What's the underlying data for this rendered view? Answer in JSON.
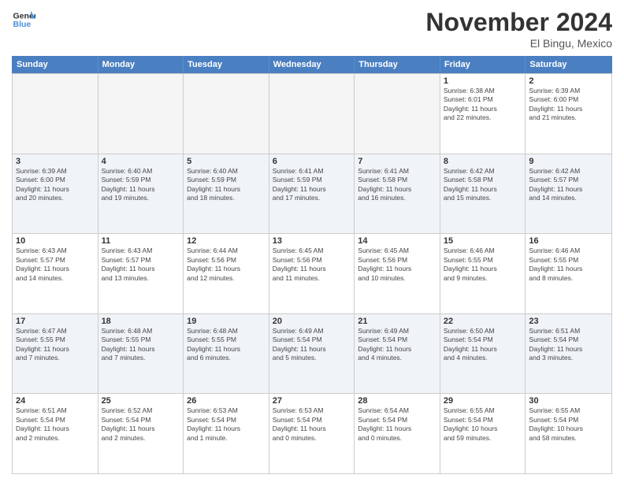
{
  "logo": {
    "line1": "General",
    "line2": "Blue"
  },
  "title": "November 2024",
  "location": "El Bingu, Mexico",
  "weekdays": [
    "Sunday",
    "Monday",
    "Tuesday",
    "Wednesday",
    "Thursday",
    "Friday",
    "Saturday"
  ],
  "rows": [
    [
      {
        "day": "",
        "text": "",
        "empty": true
      },
      {
        "day": "",
        "text": "",
        "empty": true
      },
      {
        "day": "",
        "text": "",
        "empty": true
      },
      {
        "day": "",
        "text": "",
        "empty": true
      },
      {
        "day": "",
        "text": "",
        "empty": true
      },
      {
        "day": "1",
        "text": "Sunrise: 6:38 AM\nSunset: 6:01 PM\nDaylight: 11 hours\nand 22 minutes.",
        "empty": false
      },
      {
        "day": "2",
        "text": "Sunrise: 6:39 AM\nSunset: 6:00 PM\nDaylight: 11 hours\nand 21 minutes.",
        "empty": false
      }
    ],
    [
      {
        "day": "3",
        "text": "Sunrise: 6:39 AM\nSunset: 6:00 PM\nDaylight: 11 hours\nand 20 minutes.",
        "empty": false
      },
      {
        "day": "4",
        "text": "Sunrise: 6:40 AM\nSunset: 5:59 PM\nDaylight: 11 hours\nand 19 minutes.",
        "empty": false
      },
      {
        "day": "5",
        "text": "Sunrise: 6:40 AM\nSunset: 5:59 PM\nDaylight: 11 hours\nand 18 minutes.",
        "empty": false
      },
      {
        "day": "6",
        "text": "Sunrise: 6:41 AM\nSunset: 5:59 PM\nDaylight: 11 hours\nand 17 minutes.",
        "empty": false
      },
      {
        "day": "7",
        "text": "Sunrise: 6:41 AM\nSunset: 5:58 PM\nDaylight: 11 hours\nand 16 minutes.",
        "empty": false
      },
      {
        "day": "8",
        "text": "Sunrise: 6:42 AM\nSunset: 5:58 PM\nDaylight: 11 hours\nand 15 minutes.",
        "empty": false
      },
      {
        "day": "9",
        "text": "Sunrise: 6:42 AM\nSunset: 5:57 PM\nDaylight: 11 hours\nand 14 minutes.",
        "empty": false
      }
    ],
    [
      {
        "day": "10",
        "text": "Sunrise: 6:43 AM\nSunset: 5:57 PM\nDaylight: 11 hours\nand 14 minutes.",
        "empty": false
      },
      {
        "day": "11",
        "text": "Sunrise: 6:43 AM\nSunset: 5:57 PM\nDaylight: 11 hours\nand 13 minutes.",
        "empty": false
      },
      {
        "day": "12",
        "text": "Sunrise: 6:44 AM\nSunset: 5:56 PM\nDaylight: 11 hours\nand 12 minutes.",
        "empty": false
      },
      {
        "day": "13",
        "text": "Sunrise: 6:45 AM\nSunset: 5:56 PM\nDaylight: 11 hours\nand 11 minutes.",
        "empty": false
      },
      {
        "day": "14",
        "text": "Sunrise: 6:45 AM\nSunset: 5:56 PM\nDaylight: 11 hours\nand 10 minutes.",
        "empty": false
      },
      {
        "day": "15",
        "text": "Sunrise: 6:46 AM\nSunset: 5:55 PM\nDaylight: 11 hours\nand 9 minutes.",
        "empty": false
      },
      {
        "day": "16",
        "text": "Sunrise: 6:46 AM\nSunset: 5:55 PM\nDaylight: 11 hours\nand 8 minutes.",
        "empty": false
      }
    ],
    [
      {
        "day": "17",
        "text": "Sunrise: 6:47 AM\nSunset: 5:55 PM\nDaylight: 11 hours\nand 7 minutes.",
        "empty": false
      },
      {
        "day": "18",
        "text": "Sunrise: 6:48 AM\nSunset: 5:55 PM\nDaylight: 11 hours\nand 7 minutes.",
        "empty": false
      },
      {
        "day": "19",
        "text": "Sunrise: 6:48 AM\nSunset: 5:55 PM\nDaylight: 11 hours\nand 6 minutes.",
        "empty": false
      },
      {
        "day": "20",
        "text": "Sunrise: 6:49 AM\nSunset: 5:54 PM\nDaylight: 11 hours\nand 5 minutes.",
        "empty": false
      },
      {
        "day": "21",
        "text": "Sunrise: 6:49 AM\nSunset: 5:54 PM\nDaylight: 11 hours\nand 4 minutes.",
        "empty": false
      },
      {
        "day": "22",
        "text": "Sunrise: 6:50 AM\nSunset: 5:54 PM\nDaylight: 11 hours\nand 4 minutes.",
        "empty": false
      },
      {
        "day": "23",
        "text": "Sunrise: 6:51 AM\nSunset: 5:54 PM\nDaylight: 11 hours\nand 3 minutes.",
        "empty": false
      }
    ],
    [
      {
        "day": "24",
        "text": "Sunrise: 6:51 AM\nSunset: 5:54 PM\nDaylight: 11 hours\nand 2 minutes.",
        "empty": false
      },
      {
        "day": "25",
        "text": "Sunrise: 6:52 AM\nSunset: 5:54 PM\nDaylight: 11 hours\nand 2 minutes.",
        "empty": false
      },
      {
        "day": "26",
        "text": "Sunrise: 6:53 AM\nSunset: 5:54 PM\nDaylight: 11 hours\nand 1 minute.",
        "empty": false
      },
      {
        "day": "27",
        "text": "Sunrise: 6:53 AM\nSunset: 5:54 PM\nDaylight: 11 hours\nand 0 minutes.",
        "empty": false
      },
      {
        "day": "28",
        "text": "Sunrise: 6:54 AM\nSunset: 5:54 PM\nDaylight: 11 hours\nand 0 minutes.",
        "empty": false
      },
      {
        "day": "29",
        "text": "Sunrise: 6:55 AM\nSunset: 5:54 PM\nDaylight: 10 hours\nand 59 minutes.",
        "empty": false
      },
      {
        "day": "30",
        "text": "Sunrise: 6:55 AM\nSunset: 5:54 PM\nDaylight: 10 hours\nand 58 minutes.",
        "empty": false
      }
    ]
  ]
}
